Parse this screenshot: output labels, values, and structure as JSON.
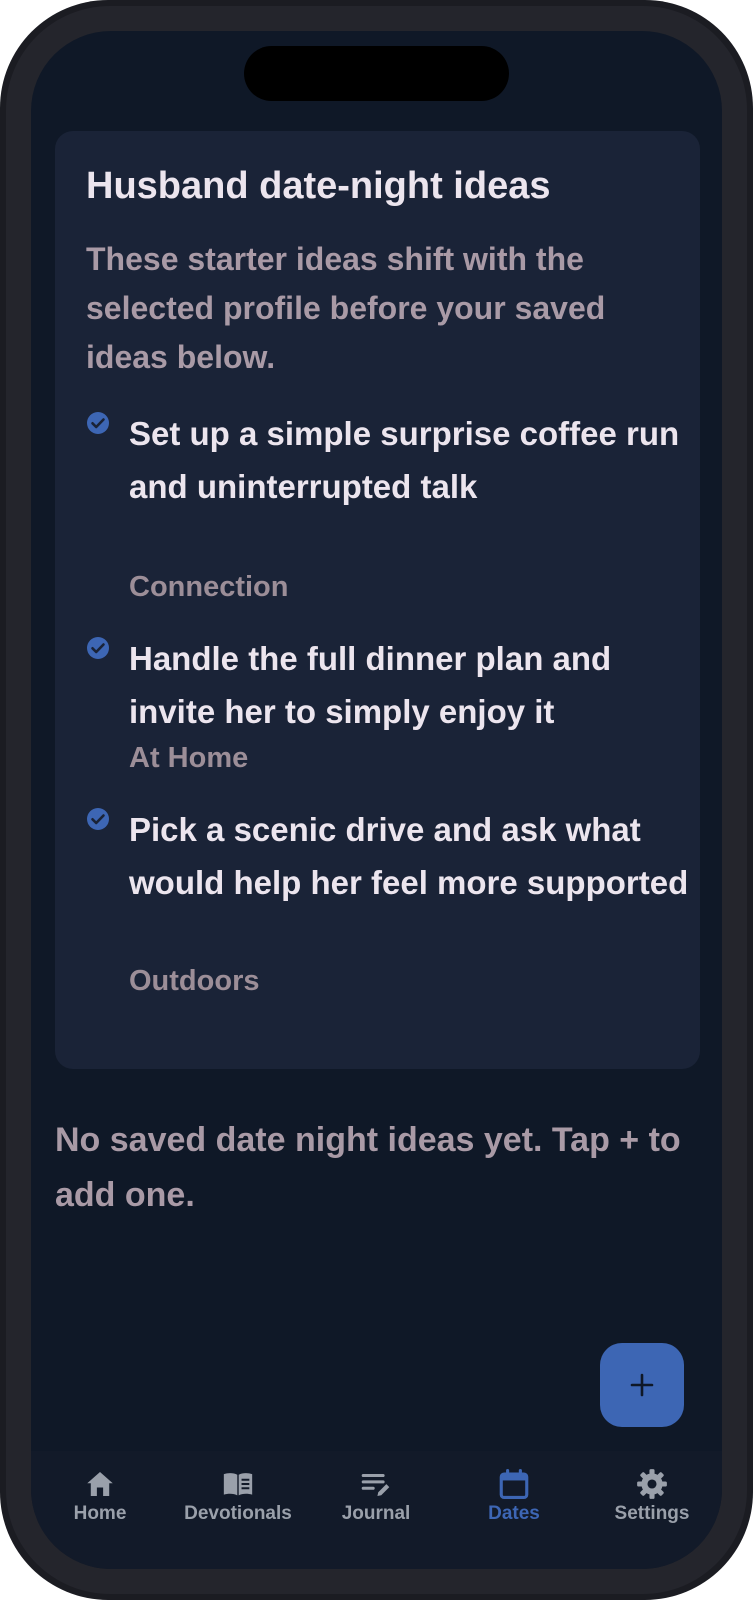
{
  "card": {
    "title": "Husband date-night ideas",
    "subtitle": "These starter ideas shift with the selected profile before your saved ideas below."
  },
  "ideas": [
    {
      "title": "Set up a simple surprise coffee run and uninterrupted talk",
      "category": "Connection",
      "icon": "check-circle-icon"
    },
    {
      "title": "Handle the full dinner plan and invite her to simply enjoy it",
      "category": "At Home",
      "icon": "check-circle-icon"
    },
    {
      "title": "Pick a scenic drive and ask what would help her feel more supported",
      "category": "Outdoors",
      "icon": "check-circle-icon"
    }
  ],
  "empty_state": "No saved date night ideas yet. Tap + to add one.",
  "fab": {
    "icon": "plus-icon"
  },
  "nav": {
    "active": "Dates",
    "items": [
      {
        "label": "Home",
        "icon": "home-icon"
      },
      {
        "label": "Devotionals",
        "icon": "book-icon"
      },
      {
        "label": "Journal",
        "icon": "journal-edit-icon"
      },
      {
        "label": "Dates",
        "icon": "calendar-icon"
      },
      {
        "label": "Settings",
        "icon": "gear-icon"
      }
    ]
  },
  "colors": {
    "background": "#0f1827",
    "card": "#1a2337",
    "accent": "#3d66b4",
    "title_text": "#ece5ee",
    "muted_text": "#a99aa6"
  }
}
